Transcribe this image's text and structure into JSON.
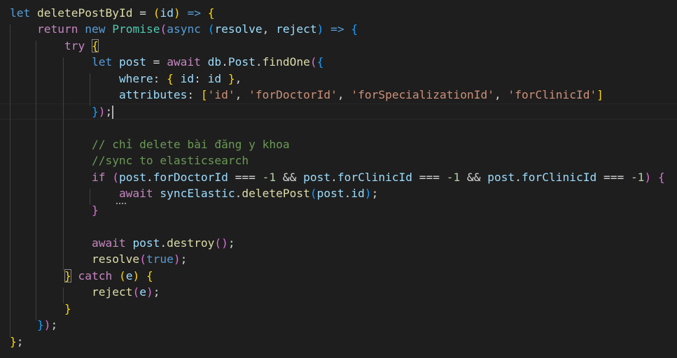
{
  "editor": {
    "lines": [
      {
        "tokens": [
          {
            "t": "let",
            "c": "kw"
          },
          {
            "t": " "
          },
          {
            "t": "deletePostById",
            "c": "fn"
          },
          {
            "t": " = "
          },
          {
            "t": "(",
            "c": "b1"
          },
          {
            "t": "id",
            "c": "var"
          },
          {
            "t": ")",
            "c": "b1"
          },
          {
            "t": " "
          },
          {
            "t": "=>",
            "c": "kw"
          },
          {
            "t": " "
          },
          {
            "t": "{",
            "c": "b1"
          }
        ]
      },
      {
        "tokens": [
          {
            "t": "    "
          },
          {
            "t": "return",
            "c": "ctl"
          },
          {
            "t": " "
          },
          {
            "t": "new",
            "c": "kw"
          },
          {
            "t": " "
          },
          {
            "t": "Promise",
            "c": "cls"
          },
          {
            "t": "(",
            "c": "b2"
          },
          {
            "t": "async",
            "c": "kw"
          },
          {
            "t": " "
          },
          {
            "t": "(",
            "c": "b3"
          },
          {
            "t": "resolve",
            "c": "var"
          },
          {
            "t": ", "
          },
          {
            "t": "reject",
            "c": "var"
          },
          {
            "t": ")",
            "c": "b3"
          },
          {
            "t": " "
          },
          {
            "t": "=>",
            "c": "kw"
          },
          {
            "t": " "
          },
          {
            "t": "{",
            "c": "b3"
          }
        ]
      },
      {
        "tokens": [
          {
            "t": "        "
          },
          {
            "t": "try",
            "c": "ctl"
          },
          {
            "t": " "
          },
          {
            "t": "{",
            "c": "b1",
            "m": 1
          }
        ]
      },
      {
        "tokens": [
          {
            "t": "            "
          },
          {
            "t": "let",
            "c": "kw"
          },
          {
            "t": " "
          },
          {
            "t": "post",
            "c": "var"
          },
          {
            "t": " = "
          },
          {
            "t": "await",
            "c": "ctl"
          },
          {
            "t": " "
          },
          {
            "t": "db",
            "c": "var"
          },
          {
            "t": "."
          },
          {
            "t": "Post",
            "c": "var"
          },
          {
            "t": "."
          },
          {
            "t": "findOne",
            "c": "fn"
          },
          {
            "t": "(",
            "c": "b2"
          },
          {
            "t": "{",
            "c": "b3"
          }
        ]
      },
      {
        "tokens": [
          {
            "t": "                "
          },
          {
            "t": "where",
            "c": "var"
          },
          {
            "t": ": "
          },
          {
            "t": "{",
            "c": "b1"
          },
          {
            "t": " "
          },
          {
            "t": "id",
            "c": "var"
          },
          {
            "t": ": "
          },
          {
            "t": "id",
            "c": "var"
          },
          {
            "t": " "
          },
          {
            "t": "}",
            "c": "b1"
          },
          {
            "t": ","
          }
        ]
      },
      {
        "tokens": [
          {
            "t": "                "
          },
          {
            "t": "attributes",
            "c": "var"
          },
          {
            "t": ": "
          },
          {
            "t": "[",
            "c": "b1"
          },
          {
            "t": "'id'",
            "c": "str"
          },
          {
            "t": ", "
          },
          {
            "t": "'forDoctorId'",
            "c": "str"
          },
          {
            "t": ", "
          },
          {
            "t": "'forSpecializationId'",
            "c": "str"
          },
          {
            "t": ", "
          },
          {
            "t": "'forClinicId'",
            "c": "str"
          },
          {
            "t": "]",
            "c": "b1"
          }
        ]
      },
      {
        "tokens": [
          {
            "t": "            "
          },
          {
            "t": "}",
            "c": "b3"
          },
          {
            "t": ")",
            "c": "b2"
          },
          {
            "t": ";"
          },
          {
            "cursor": 1
          }
        ]
      },
      {
        "tokens": []
      },
      {
        "tokens": [
          {
            "t": "            "
          },
          {
            "t": "// chỉ delete bài đăng y khoa",
            "c": "cmt"
          }
        ]
      },
      {
        "tokens": [
          {
            "t": "            "
          },
          {
            "t": "//sync to elasticsearch",
            "c": "cmt"
          }
        ]
      },
      {
        "tokens": [
          {
            "t": "            "
          },
          {
            "t": "if",
            "c": "ctl"
          },
          {
            "t": " "
          },
          {
            "t": "(",
            "c": "b2"
          },
          {
            "t": "post",
            "c": "var"
          },
          {
            "t": "."
          },
          {
            "t": "forDoctorId",
            "c": "var"
          },
          {
            "t": " === "
          },
          {
            "t": "-1",
            "c": "num"
          },
          {
            "t": " && "
          },
          {
            "t": "post",
            "c": "var"
          },
          {
            "t": "."
          },
          {
            "t": "forClinicId",
            "c": "var"
          },
          {
            "t": " === "
          },
          {
            "t": "-1",
            "c": "num"
          },
          {
            "t": " && "
          },
          {
            "t": "post",
            "c": "var"
          },
          {
            "t": "."
          },
          {
            "t": "forClinicId",
            "c": "var"
          },
          {
            "t": " === "
          },
          {
            "t": "-1",
            "c": "num"
          },
          {
            "t": ")",
            "c": "b2"
          },
          {
            "t": " "
          },
          {
            "t": "{",
            "c": "b2"
          }
        ]
      },
      {
        "tokens": [
          {
            "t": "                "
          },
          {
            "t": "await",
            "c": "ctl"
          },
          {
            "t": " "
          },
          {
            "t": "syncElastic",
            "c": "var"
          },
          {
            "t": "."
          },
          {
            "t": "deletePost",
            "c": "fn"
          },
          {
            "t": "(",
            "c": "b3"
          },
          {
            "t": "post",
            "c": "var"
          },
          {
            "t": "."
          },
          {
            "t": "id",
            "c": "var"
          },
          {
            "t": ")",
            "c": "b3"
          },
          {
            "t": ";"
          }
        ]
      },
      {
        "tokens": [
          {
            "t": "            "
          },
          {
            "t": "}",
            "c": "b2"
          }
        ]
      },
      {
        "tokens": []
      },
      {
        "tokens": [
          {
            "t": "            "
          },
          {
            "t": "await",
            "c": "ctl"
          },
          {
            "t": " "
          },
          {
            "t": "post",
            "c": "var"
          },
          {
            "t": "."
          },
          {
            "t": "destroy",
            "c": "fn"
          },
          {
            "t": "(",
            "c": "b2"
          },
          {
            "t": ")",
            "c": "b2"
          },
          {
            "t": ";"
          }
        ]
      },
      {
        "tokens": [
          {
            "t": "            "
          },
          {
            "t": "resolve",
            "c": "fn"
          },
          {
            "t": "(",
            "c": "b2"
          },
          {
            "t": "true",
            "c": "kw"
          },
          {
            "t": ")",
            "c": "b2"
          },
          {
            "t": ";"
          }
        ]
      },
      {
        "tokens": [
          {
            "t": "        "
          },
          {
            "t": "}",
            "c": "b1",
            "m": 1
          },
          {
            "t": " "
          },
          {
            "t": "catch",
            "c": "ctl"
          },
          {
            "t": " "
          },
          {
            "t": "(",
            "c": "b1"
          },
          {
            "t": "e",
            "c": "var"
          },
          {
            "t": ")",
            "c": "b1"
          },
          {
            "t": " "
          },
          {
            "t": "{",
            "c": "b1"
          }
        ]
      },
      {
        "tokens": [
          {
            "t": "            "
          },
          {
            "t": "reject",
            "c": "fn"
          },
          {
            "t": "(",
            "c": "b2"
          },
          {
            "t": "e",
            "c": "var"
          },
          {
            "t": ")",
            "c": "b2"
          },
          {
            "t": ";"
          }
        ]
      },
      {
        "tokens": [
          {
            "t": "        "
          },
          {
            "t": "}",
            "c": "b1"
          }
        ]
      },
      {
        "tokens": [
          {
            "t": "    "
          },
          {
            "t": "}",
            "c": "b3"
          },
          {
            "t": ")",
            "c": "b2"
          },
          {
            "t": ";"
          }
        ]
      },
      {
        "tokens": [
          {
            "t": "}",
            "c": "b1"
          },
          {
            "t": ";"
          }
        ]
      }
    ],
    "colors": {
      "background": "#1e1e1e",
      "keyword": "#569cd6",
      "control": "#c586c0",
      "function": "#dcdcaa",
      "variable": "#9cdcfe",
      "class": "#4ec9b0",
      "string": "#ce9178",
      "number": "#b5cea8",
      "comment": "#6a9955",
      "bracket_level_1": "#ffd700",
      "bracket_level_2": "#da70d6",
      "bracket_level_3": "#179fff"
    }
  }
}
